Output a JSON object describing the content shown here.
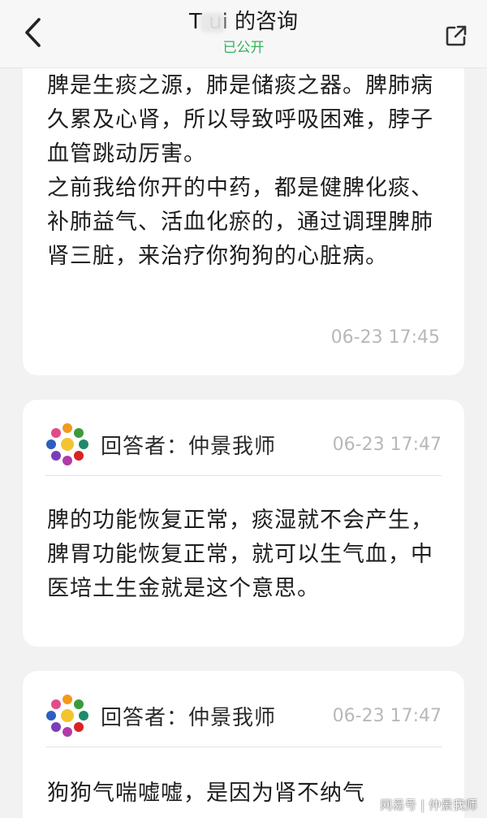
{
  "header": {
    "title": "T   ui 的咨询",
    "status": "已公开",
    "back_icon": "chevron-left-icon",
    "share_icon": "share-external-icon"
  },
  "messages": [
    {
      "text": "脾是生痰之源，肺是储痰之器。脾肺病久累及心肾，所以导致呼吸困难，脖子血管跳动厉害。\n之前我给你开的中药，都是健脾化痰、补肺益气、活血化瘀的，通过调理脾肺肾三脏，来治疗你狗狗的心脏病。",
      "time": "06-23 17:45"
    },
    {
      "responder": "回答者：仲景我师",
      "time": "06-23 17:47",
      "text": "脾的功能恢复正常，痰湿就不会产生，脾胃功能恢复正常，就可以生气血，中医培土生金就是这个意思。"
    },
    {
      "responder": "回答者：仲景我师",
      "time": "06-23 17:47",
      "text": "狗狗气喘嘘嘘，是因为肾不纳气"
    }
  ],
  "watermark": "网易号 | 仲景我师",
  "colors": {
    "accent_green": "#33b35a",
    "time_gray": "#b8b8b8",
    "background": "#f2f2f2",
    "card": "#ffffff"
  }
}
